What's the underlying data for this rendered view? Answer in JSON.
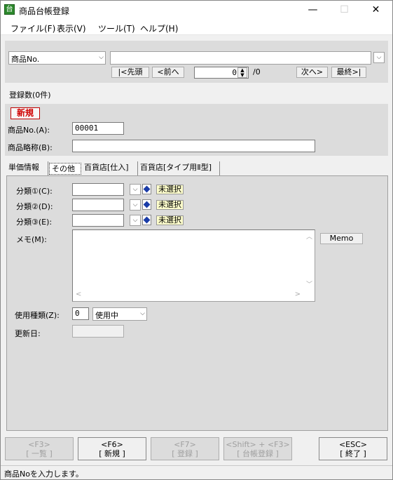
{
  "window": {
    "title": "商品台帳登録",
    "icon_glyph": "台",
    "minimize": "—",
    "maximize": "☐",
    "close": "✕"
  },
  "menu": [
    "ファイル(F)",
    "表示(V)",
    "ツール(T)",
    "ヘルプ(H)"
  ],
  "search": {
    "field_select": "商品No.",
    "keyword": "",
    "first_btn": "|<先頭",
    "prev_btn": "<前へ",
    "page_value": "0",
    "page_total": "/0",
    "next_btn": "次へ>",
    "last_btn": "最終>|"
  },
  "count_label": "登録数(0件)",
  "record": {
    "mode_badge": "新規",
    "product_no_label": "商品No.(A):",
    "product_no_value": "00001",
    "abbrev_label": "商品略称(B):",
    "abbrev_value": ""
  },
  "tabs": [
    "単価情報",
    "その他",
    "百貨店[仕入]",
    "百貨店[タイプ用Ⅱ型]"
  ],
  "other_tab": {
    "categories": [
      {
        "label": "分類①(C):",
        "value": "",
        "status": "未選択"
      },
      {
        "label": "分類②(D):",
        "value": "",
        "status": "未選択"
      },
      {
        "label": "分類③(E):",
        "value": "",
        "status": "未選択"
      }
    ],
    "memo_label": "メモ(M):",
    "memo_value": "",
    "memo_button": "Memo",
    "usage_label": "使用種類(Z):",
    "usage_code": "0",
    "usage_select": "使用中",
    "updated_label": "更新日:",
    "updated_value": ""
  },
  "function_keys": [
    {
      "key": "<F3>",
      "label": "[ 一覧 ]",
      "enabled": false
    },
    {
      "key": "<F6>",
      "label": "[ 新規 ]",
      "enabled": true
    },
    {
      "key": "<F7>",
      "label": "[ 登録 ]",
      "enabled": false
    },
    {
      "key": "<Shift> + <F3>",
      "label": "[ 台帳登録 ]",
      "enabled": false
    },
    {
      "key": "<ESC>",
      "label": "[ 終了 ]",
      "enabled": true
    }
  ],
  "status_text": "商品Noを入力します。"
}
